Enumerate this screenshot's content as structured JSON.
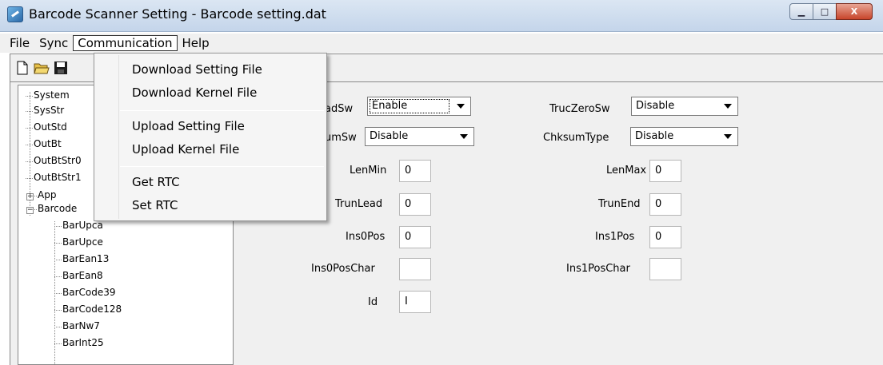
{
  "window": {
    "title": "Barcode Scanner Setting - Barcode setting.dat",
    "buttons": {
      "minimize": "▁",
      "maximize": "□",
      "close": "X"
    }
  },
  "menubar": {
    "items": [
      "File",
      "Sync",
      "Communication",
      "Help"
    ],
    "active": "Communication"
  },
  "toolbar": {
    "icons": [
      "new-file-icon",
      "open-folder-icon",
      "save-disk-icon"
    ]
  },
  "communication_menu": {
    "items": [
      "Download Setting File",
      "Download Kernel File",
      "Upload Setting File",
      "Upload Kernel File",
      "Get RTC",
      "Set RTC"
    ]
  },
  "tree": {
    "items": [
      "System",
      "SysStr",
      "OutStd",
      "OutBt",
      "OutBtStr0",
      "OutBtStr1",
      "App",
      "Barcode",
      "BarUpca",
      "BarUpce",
      "BarEan13",
      "BarEan8",
      "BarCode39",
      "BarCode128",
      "BarNw7",
      "BarInt25"
    ],
    "expander_collapsed": "+",
    "expander_expanded": "−"
  },
  "form": {
    "labels": {
      "lead_sw": "adSw",
      "trunc_zero_sw": "TrucZeroSw",
      "chksum_sw": "umSw",
      "chksum_type": "ChksumType",
      "len_min": "LenMin",
      "len_max": "LenMax",
      "trun_lead": "TrunLead",
      "trun_end": "TrunEnd",
      "ins0_pos": "Ins0Pos",
      "ins1_pos": "Ins1Pos",
      "ins0_pos_char": "Ins0PosChar",
      "ins1_pos_char": "Ins1PosChar",
      "id": "Id"
    },
    "values": {
      "lead_sw": "Enable",
      "trunc_zero_sw": "Disable",
      "chksum_sw": "Disable",
      "chksum_type": "Disable",
      "len_min": "0",
      "len_max": "0",
      "trun_lead": "0",
      "trun_end": "0",
      "ins0_pos": "0",
      "ins1_pos": "0",
      "ins0_pos_char": "",
      "ins1_pos_char": "",
      "id": "I"
    }
  }
}
